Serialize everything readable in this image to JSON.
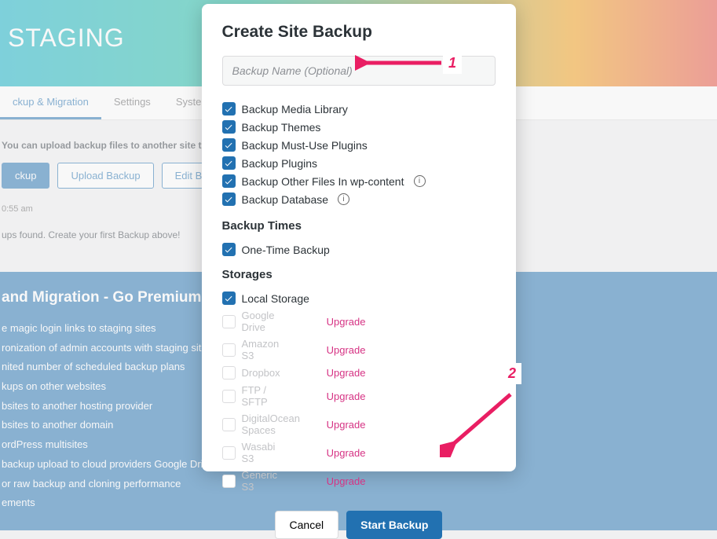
{
  "brand": "STAGING",
  "tabs": [
    {
      "label": "ckup & Migration",
      "active": true
    },
    {
      "label": "Settings",
      "active": false
    },
    {
      "label": "System Info",
      "active": false
    }
  ],
  "hint": "You can upload backup files to another site to tran",
  "buttons": {
    "create": "ckup",
    "upload": "Upload Backup",
    "edit": "Edit Backu"
  },
  "time": "0:55 am",
  "no_backups": "ups found. Create your first Backup above!",
  "premium": {
    "title": "and Migration - Go Premium!",
    "items": [
      "e magic login links to staging sites",
      "ronization of admin accounts with staging sites",
      "nited number of scheduled backup plans",
      "kups on other websites",
      "bsites to another hosting provider",
      "bsites to another domain",
      "ordPress multisites",
      "backup upload to cloud providers Google Drive, A",
      "or raw backup and cloning performance",
      "ements"
    ]
  },
  "modal": {
    "title": "Create Site Backup",
    "placeholder": "Backup Name (Optional)",
    "options": [
      {
        "label": "Backup Media Library",
        "info": false
      },
      {
        "label": "Backup Themes",
        "info": false
      },
      {
        "label": "Backup Must-Use Plugins",
        "info": false
      },
      {
        "label": "Backup Plugins",
        "info": false
      },
      {
        "label": "Backup Other Files In wp-content",
        "info": true
      },
      {
        "label": "Backup Database",
        "info": true
      }
    ],
    "times_heading": "Backup Times",
    "one_time": "One-Time Backup",
    "storages_heading": "Storages",
    "local": "Local Storage",
    "providers": [
      "Google Drive",
      "Amazon S3",
      "Dropbox",
      "FTP / SFTP",
      "DigitalOcean Spaces",
      "Wasabi S3",
      "Generic S3"
    ],
    "upgrade": "Upgrade",
    "cancel": "Cancel",
    "start": "Start Backup"
  },
  "anno": {
    "one": "1",
    "two": "2"
  }
}
